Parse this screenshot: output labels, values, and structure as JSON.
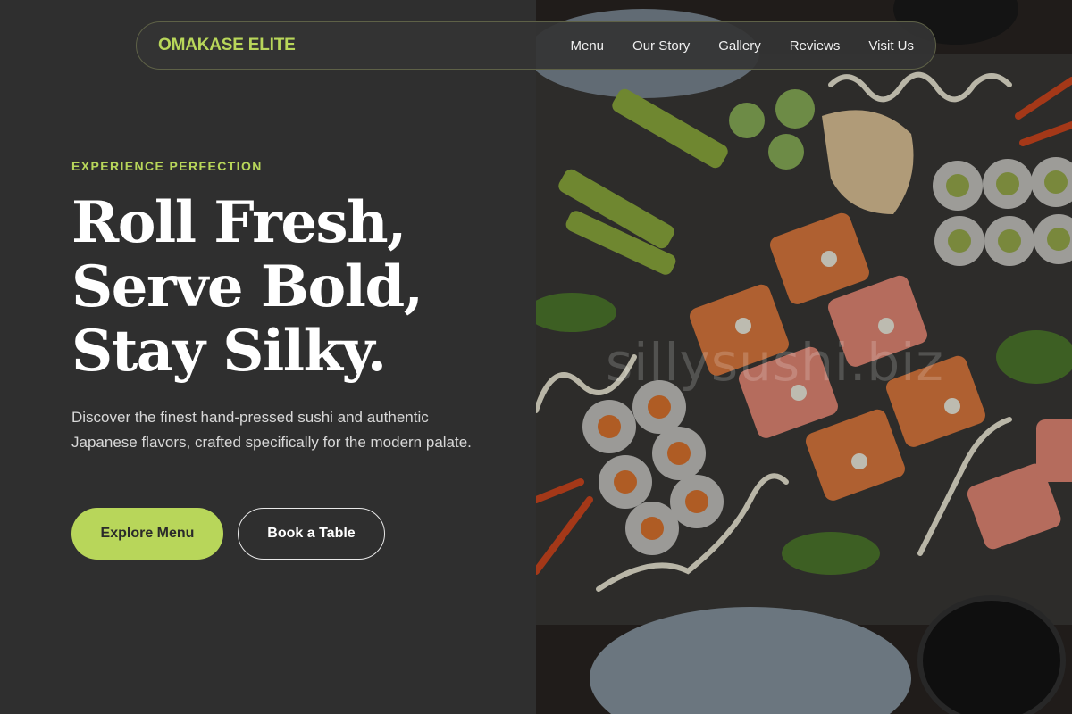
{
  "brand": "OMAKASE ELITE",
  "nav": [
    "Menu",
    "Our Story",
    "Gallery",
    "Reviews",
    "Visit Us"
  ],
  "hero": {
    "eyebrow": "EXPERIENCE PERFECTION",
    "headline": [
      "Roll Fresh,",
      "Serve Bold,",
      "Stay Silky."
    ],
    "description": "Discover the finest hand-pressed sushi and authentic Japanese flavors, crafted specifically for the modern palate.",
    "primary_cta": "Explore Menu",
    "secondary_cta": "Book a Table"
  },
  "image": {
    "watermark": "sillysushi.biz"
  },
  "colors": {
    "accent": "#b8d65a",
    "background": "#2f2f2f"
  }
}
